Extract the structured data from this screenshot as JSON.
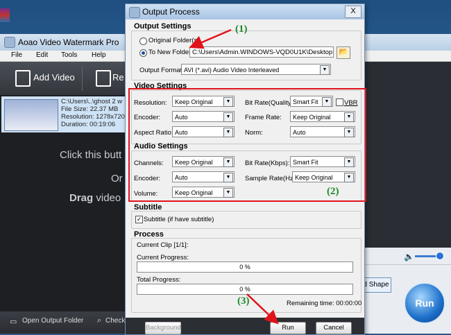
{
  "main_window": {
    "title": "Aoao Video Watermark Pro",
    "menu": [
      "File",
      "Edit",
      "Tools",
      "Help"
    ],
    "toolbar": {
      "add_video": "Add Video",
      "remove": "Re"
    },
    "file_item": {
      "path": "C:\\Users\\..\\ghost 2 w",
      "size": "File Size: 22.37 MB",
      "resolution": "Resolution: 1278x720",
      "duration": "Duration: 00:19:06"
    },
    "hints": {
      "click": "Click this butt",
      "or": "Or",
      "drag": "Drag video"
    },
    "bottom": {
      "open_folder": "Open Output Folder",
      "check": "Check"
    },
    "shape_button": "d Shape",
    "run_button": "Run"
  },
  "dialog": {
    "title": "Output Process",
    "close": "X",
    "output_settings": {
      "header": "Output Settings",
      "original_folder": "Original Folder(s)",
      "new_folder": "To New Folder",
      "folder_path": "C:\\Users\\Admin.WINDOWS-VQD0U1K\\Desktop",
      "format_label": "Output Format :",
      "format_value": "AVI  (*.avi) Audio Video Interleaved"
    },
    "video_settings": {
      "header": "Video Settings",
      "resolution_label": "Resolution:",
      "resolution_value": "Keep Original",
      "bitrate_label": "Bit Rate(Quality):",
      "bitrate_value": "Smart Fit",
      "vbr_label": "VBR",
      "encoder_label": "Encoder:",
      "encoder_value": "Auto",
      "framerate_label": "Frame Rate:",
      "framerate_value": "Keep Original",
      "aspect_label": "Aspect Ratio:",
      "aspect_value": "Auto",
      "norm_label": "Norm:",
      "norm_value": "Auto"
    },
    "audio_settings": {
      "header": "Audio Settings",
      "channels_label": "Channels:",
      "channels_value": "Keep Original",
      "bitrate_label": "Bit Rate(Kbps):",
      "bitrate_value": "Smart Fit",
      "encoder_label": "Encoder:",
      "encoder_value": "Auto",
      "samplerate_label": "Sample Rate(Hz):",
      "samplerate_value": "Keep Original",
      "volume_label": "Volume:",
      "volume_value": "Keep Original"
    },
    "subtitle": {
      "header": "Subtitle",
      "checkbox_label": "Subtitle (if have subtitle)"
    },
    "process": {
      "header": "Process",
      "current_clip": "Current Clip [1/1]:",
      "current_progress_label": "Current Progress:",
      "current_progress_value": "0 %",
      "current_progress_fraction": 0,
      "total_progress_label": "Total Progress:",
      "total_progress_value": "0 %",
      "total_progress_fraction": 0,
      "remaining": "Remaining time: 00:00:00"
    },
    "buttons": {
      "background": "Background",
      "run": "Run",
      "cancel": "Cancel"
    }
  },
  "annotations": {
    "one": "(1)",
    "two": "(2)",
    "three": "(3)"
  },
  "colors": {
    "highlight_box": "#e0131a",
    "annotation_text": "#1d8a2a",
    "arrow": "#e0131a"
  }
}
